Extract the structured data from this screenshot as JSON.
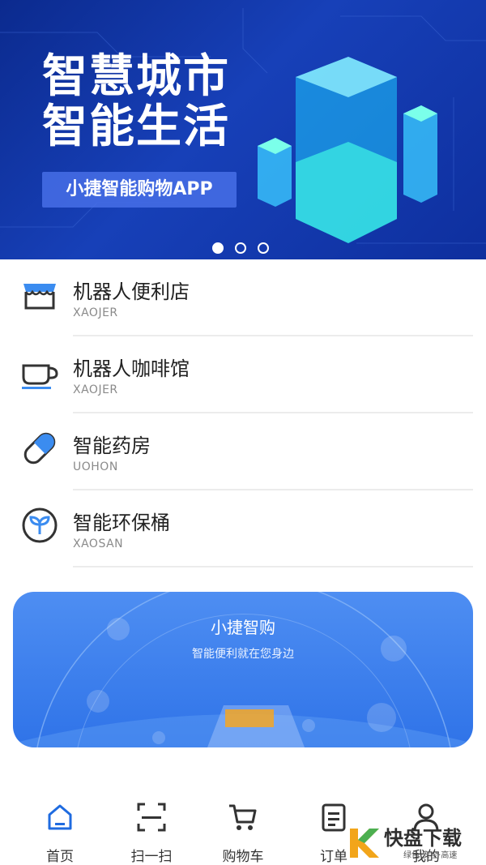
{
  "banner": {
    "title_line1": "智慧城市",
    "title_line2": "智能生活",
    "tag": "小捷智能购物APP",
    "pages": 3,
    "active_page": 1
  },
  "list": [
    {
      "title": "机器人便利店",
      "sub": "XAOJER",
      "icon": "store-icon"
    },
    {
      "title": "机器人咖啡馆",
      "sub": "XAOJER",
      "icon": "coffee-cup-icon"
    },
    {
      "title": "智能药房",
      "sub": "UOHON",
      "icon": "pill-icon"
    },
    {
      "title": "智能环保桶",
      "sub": "XAOSAN",
      "icon": "sprout-icon"
    }
  ],
  "promo": {
    "title": "小捷智购",
    "subtitle": "智能便利就在您身边"
  },
  "nav": [
    {
      "label": "首页",
      "icon": "home-icon",
      "active": true
    },
    {
      "label": "扫一扫",
      "icon": "scan-icon"
    },
    {
      "label": "购物车",
      "icon": "cart-icon"
    },
    {
      "label": "订单",
      "icon": "order-icon"
    },
    {
      "label": "我的",
      "icon": "user-icon"
    }
  ],
  "watermark": {
    "main": "快盘下载",
    "sub": "绿色·安全·高速"
  },
  "colors": {
    "accent": "#2f73e8",
    "banner_bg": "#1740b8",
    "active_nav": "#1f6be0"
  }
}
